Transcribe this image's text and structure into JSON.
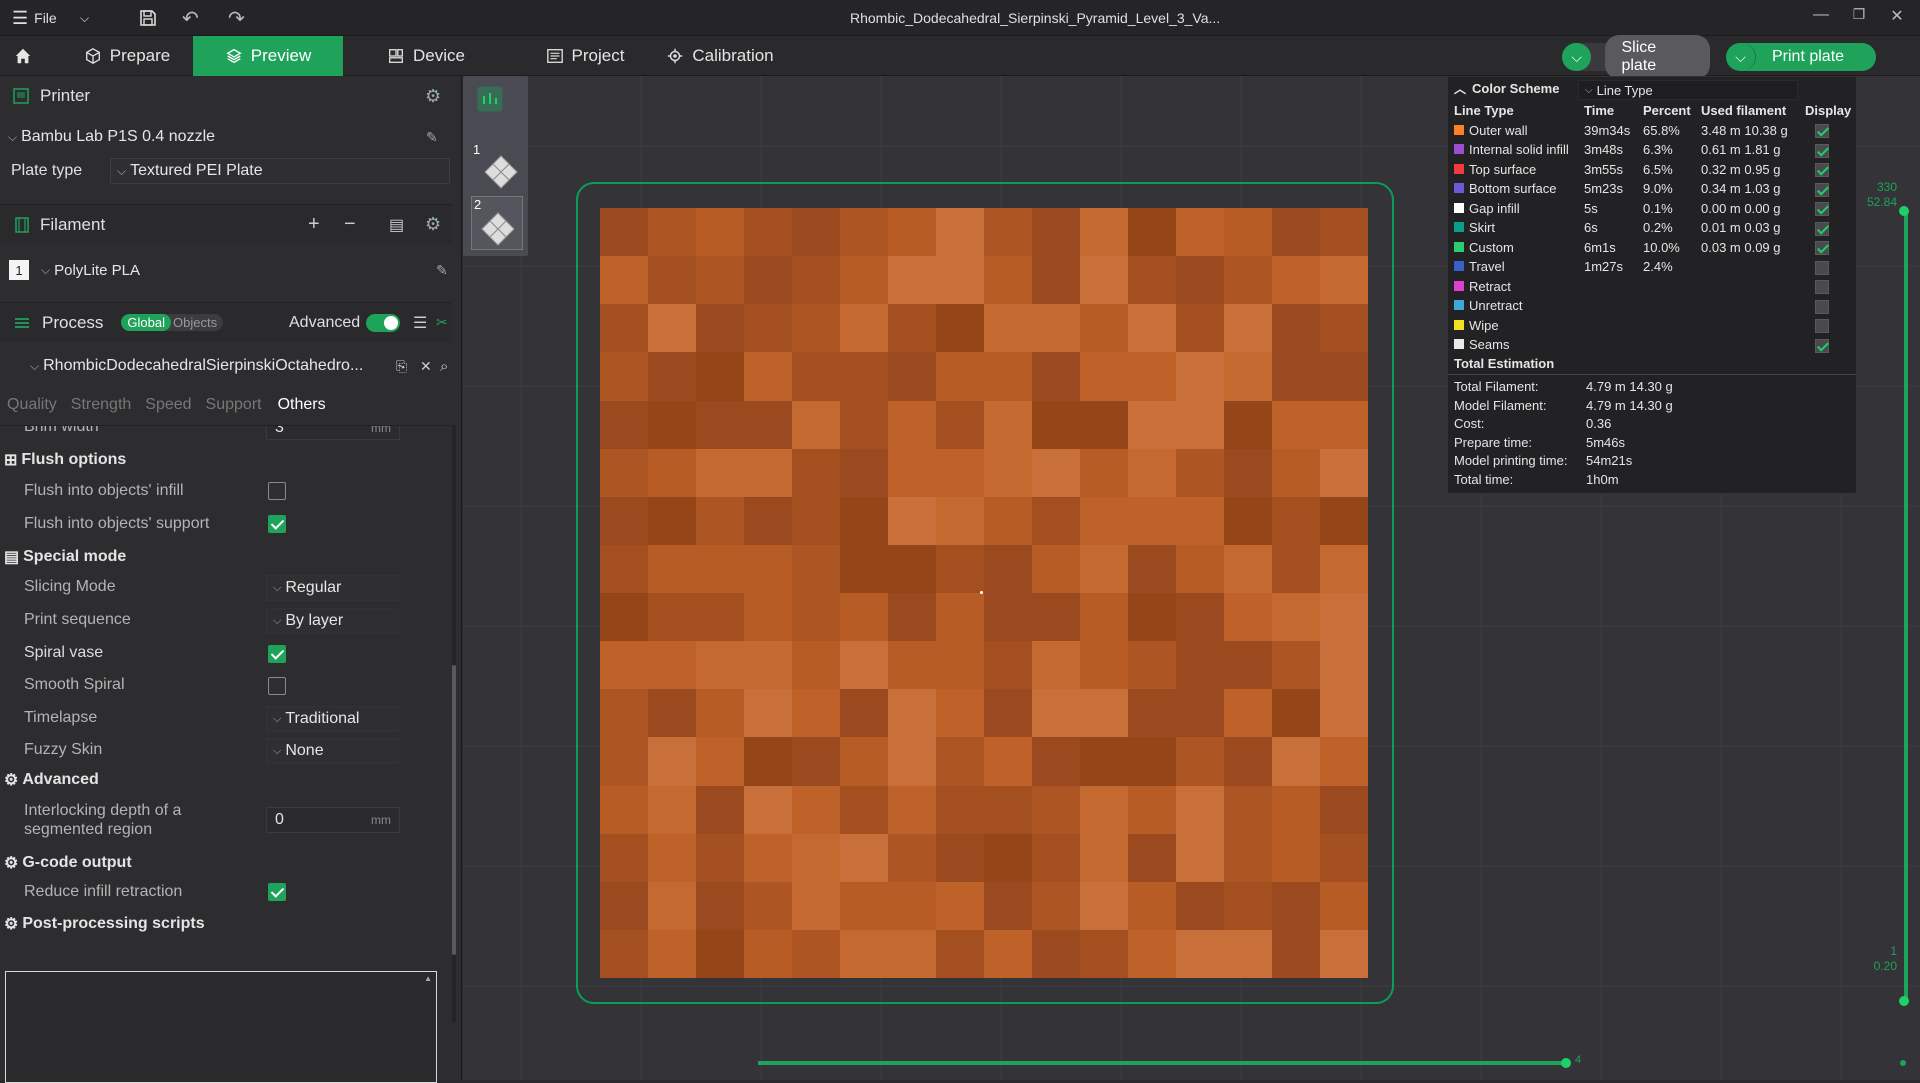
{
  "titlebar": {
    "menu_label": "File",
    "title": "Rhombic_Dodecahedral_Sierpinski_Pyramid_Level_3_Va..."
  },
  "tabs": {
    "prepare": "Prepare",
    "preview": "Preview",
    "device": "Device",
    "project": "Project",
    "calibration": "Calibration"
  },
  "actions": {
    "slice": "Slice plate",
    "print": "Print plate"
  },
  "printer": {
    "header": "Printer",
    "name": "Bambu Lab P1S 0.4 nozzle",
    "plate_type_label": "Plate type",
    "plate_type": "Textured PEI Plate"
  },
  "filament": {
    "header": "Filament",
    "slot": "1",
    "name": "PolyLite PLA"
  },
  "process": {
    "header": "Process",
    "global": "Global",
    "objects": "Objects",
    "advanced_label": "Advanced",
    "profile": "RhombicDodecahedralSierpinskiOctahedro..."
  },
  "settings_tabs": [
    "Quality",
    "Strength",
    "Speed",
    "Support",
    "Others"
  ],
  "settings": {
    "brim_width_label": "Brim width",
    "brim_width": "3",
    "unit_mm": "mm",
    "flush_options": "Flush options",
    "flush_infill": "Flush into objects' infill",
    "flush_support": "Flush into objects' support",
    "special_mode": "Special mode",
    "slicing_mode_label": "Slicing Mode",
    "slicing_mode": "Regular",
    "print_sequence_label": "Print sequence",
    "print_sequence": "By layer",
    "spiral_vase": "Spiral vase",
    "smooth_spiral": "Smooth Spiral",
    "timelapse_label": "Timelapse",
    "timelapse": "Traditional",
    "fuzzy_skin_label": "Fuzzy Skin",
    "fuzzy_skin": "None",
    "advanced": "Advanced",
    "interlock_label_1": "Interlocking depth of a",
    "interlock_label_2": "segmented region",
    "interlock_value": "0",
    "gcode_output": "G-code output",
    "reduce_retraction": "Reduce infill retraction",
    "post_processing": "Post-processing scripts"
  },
  "plates": [
    "1",
    "2"
  ],
  "legend": {
    "color_scheme_label": "Color Scheme",
    "scheme": "Line Type",
    "headers": [
      "Line Type",
      "Time",
      "Percent",
      "Used filament",
      "Display"
    ],
    "rows": [
      {
        "name": "Outer wall",
        "color": "#ff7f27",
        "time": "39m34s",
        "percent": "65.8%",
        "filament": "3.48 m  10.38 g",
        "display": true
      },
      {
        "name": "Internal solid infill",
        "color": "#9a4fd0",
        "time": "3m48s",
        "percent": "6.3%",
        "filament": "0.61 m  1.81 g",
        "display": true
      },
      {
        "name": "Top surface",
        "color": "#f03c3c",
        "time": "3m55s",
        "percent": "6.5%",
        "filament": "0.32 m  0.95 g",
        "display": true
      },
      {
        "name": "Bottom surface",
        "color": "#6a5ad8",
        "time": "5m23s",
        "percent": "9.0%",
        "filament": "0.34 m  1.03 g",
        "display": true
      },
      {
        "name": "Gap infill",
        "color": "#ffffff",
        "time": "5s",
        "percent": "0.1%",
        "filament": "0.00 m  0.00 g",
        "display": true
      },
      {
        "name": "Skirt",
        "color": "#0a9e8a",
        "time": "6s",
        "percent": "0.2%",
        "filament": "0.01 m  0.03 g",
        "display": true
      },
      {
        "name": "Custom",
        "color": "#2ecc71",
        "time": "6m1s",
        "percent": "10.0%",
        "filament": "0.03 m  0.09 g",
        "display": true
      },
      {
        "name": "Travel",
        "color": "#3a5fc8",
        "time": "1m27s",
        "percent": "2.4%",
        "filament": "",
        "display": false
      },
      {
        "name": "Retract",
        "color": "#e040d0",
        "time": "",
        "percent": "",
        "filament": "",
        "display": false
      },
      {
        "name": "Unretract",
        "color": "#40a8d8",
        "time": "",
        "percent": "",
        "filament": "",
        "display": false
      },
      {
        "name": "Wipe",
        "color": "#f0e020",
        "time": "",
        "percent": "",
        "filament": "",
        "display": false
      },
      {
        "name": "Seams",
        "color": "#e8e8e8",
        "time": "",
        "percent": "",
        "filament": "",
        "display": true
      }
    ],
    "total_header": "Total Estimation",
    "totals": [
      {
        "label": "Total Filament:",
        "value": "4.79 m    14.30 g"
      },
      {
        "label": "Model Filament:",
        "value": "4.79 m    14.30 g"
      },
      {
        "label": "Cost:",
        "value": "0.36"
      },
      {
        "label": "Prepare time:",
        "value": "5m46s"
      },
      {
        "label": "Model printing time:",
        "value": "54m21s"
      },
      {
        "label": "Total time:",
        "value": "1h0m"
      }
    ]
  },
  "layer_slider": {
    "top_layer": "330",
    "top_height": "52.84",
    "bottom_layer": "1",
    "bottom_height": "0.20"
  },
  "move_slider": {
    "value": "4"
  },
  "colors": {
    "accent": "#1fa25a",
    "model": "#c0622a"
  }
}
